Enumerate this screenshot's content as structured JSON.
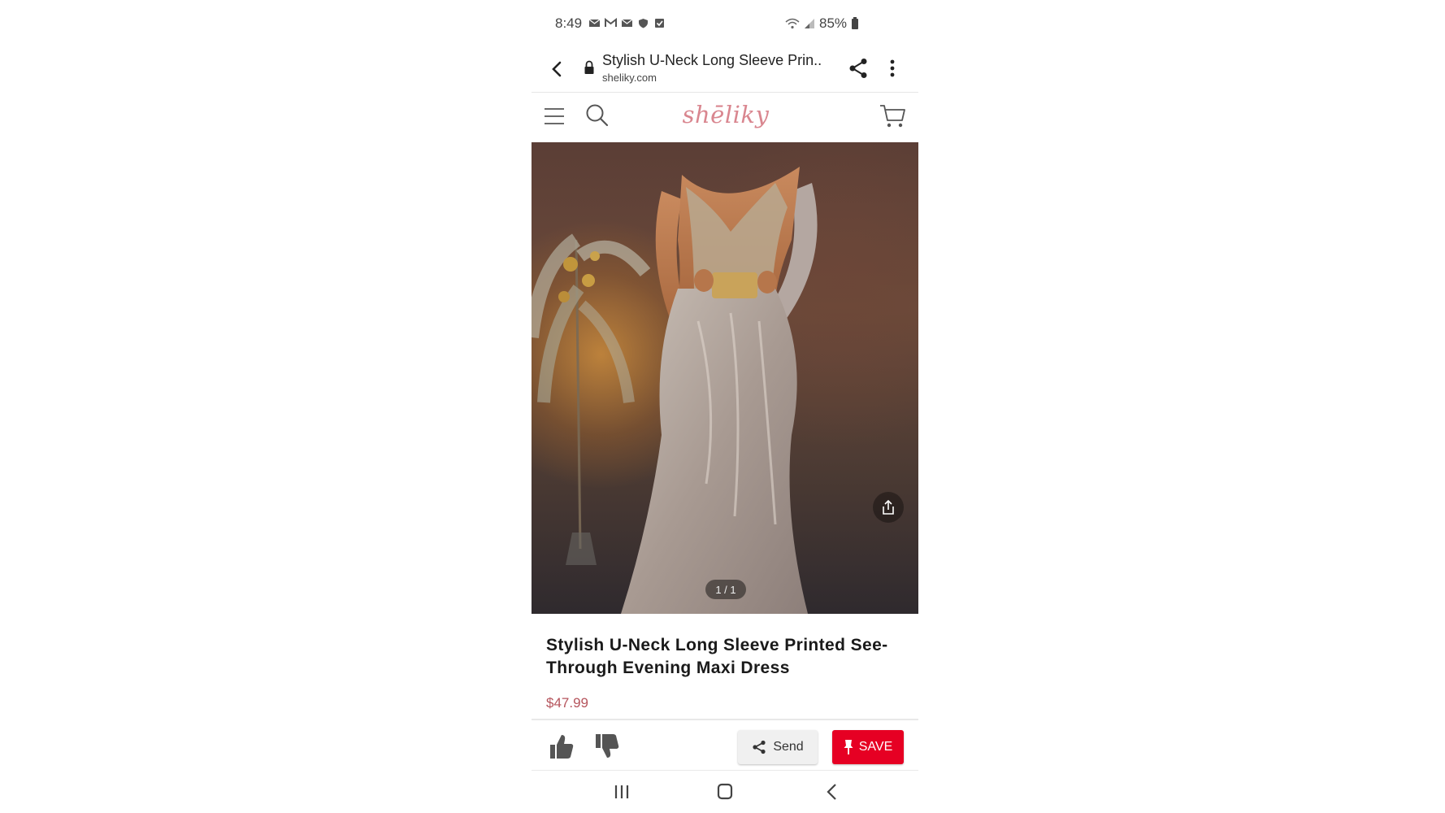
{
  "status_bar": {
    "time": "8:49",
    "notification_icons": [
      "mail-icon",
      "gmail-icon",
      "mail-icon",
      "shield-icon",
      "check-icon"
    ],
    "battery_text": "85%"
  },
  "browser": {
    "page_title": "Stylish U-Neck Long Sleeve Prin...",
    "domain": "sheliky.com"
  },
  "site": {
    "logo_text": "shēliky"
  },
  "product": {
    "image_counter": "1 / 1",
    "title": "Stylish U-Neck Long Sleeve Printed See-Through Evening Maxi Dress",
    "price": "$47.99"
  },
  "actions": {
    "send_label": "Send",
    "save_label": "SAVE",
    "save_color": "#e60023"
  },
  "colors": {
    "logo": "#d9868f",
    "price": "#b5545c"
  }
}
